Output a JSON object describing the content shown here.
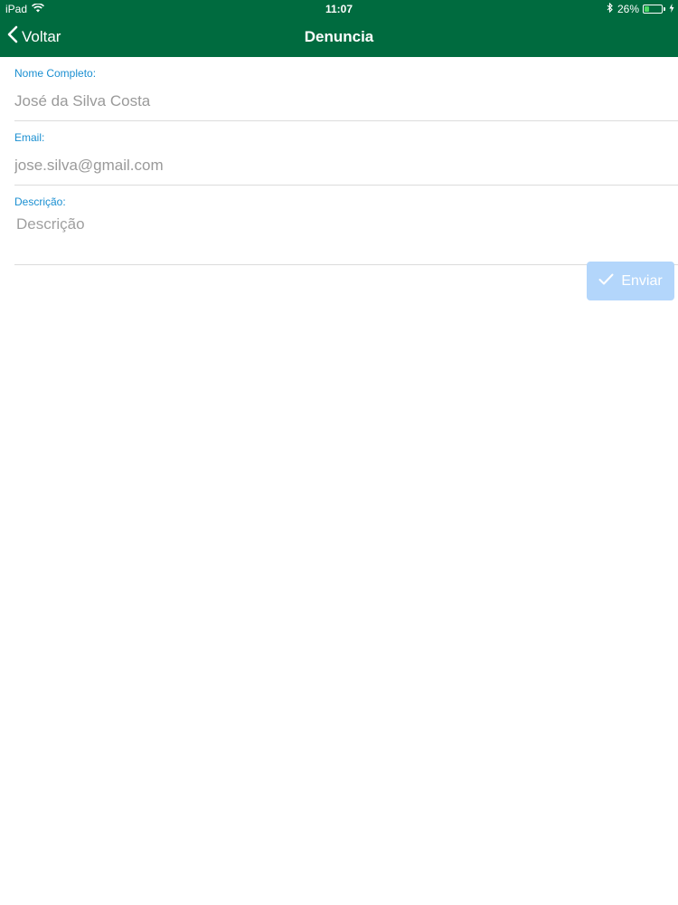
{
  "status_bar": {
    "device": "iPad",
    "time": "11:07",
    "battery": "26%",
    "battery_level": 0.26,
    "icons": [
      "wifi-icon",
      "bluetooth-icon",
      "battery-icon",
      "charging-icon"
    ]
  },
  "nav": {
    "back_label": "Voltar",
    "title": "Denuncia"
  },
  "form": {
    "name_label": "Nome Completo:",
    "name_placeholder": "José da Silva Costa",
    "email_label": "Email:",
    "email_placeholder": "jose.silva@gmail.com",
    "description_label": "Descrição:",
    "description_placeholder": "Descrição"
  },
  "submit": {
    "label": "Enviar",
    "icon": "checkmark-icon"
  },
  "colors": {
    "header_bg": "#006b3f",
    "label_color": "#1a8fd1",
    "button_bg": "#b3d6fb"
  }
}
